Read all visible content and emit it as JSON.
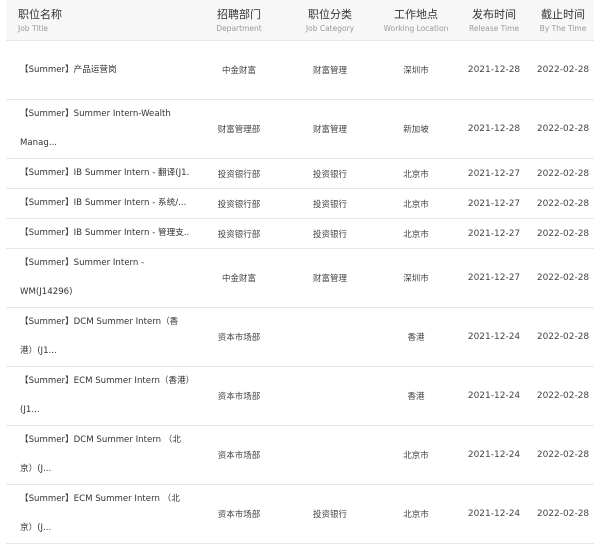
{
  "header": {
    "title": {
      "zh": "职位名称",
      "en": "Job Title"
    },
    "department": {
      "zh": "招聘部门",
      "en": "Department"
    },
    "category": {
      "zh": "职位分类",
      "en": "Job Category"
    },
    "location": {
      "zh": "工作地点",
      "en": "Working Location"
    },
    "release": {
      "zh": "发布时间",
      "en": "Release Time"
    },
    "deadline": {
      "zh": "截止时间",
      "en": "By The Time"
    }
  },
  "rows": [
    {
      "title": "【Summer】产品运营岗",
      "department": "中金财富",
      "category": "财富管理",
      "location": "深圳市",
      "release": "2021-12-28",
      "deadline": "2022-02-28"
    },
    {
      "title": "【Summer】Summer Intern-Wealth Manag...",
      "department": "财富管理部",
      "category": "财富管理",
      "location": "新加坡",
      "release": "2021-12-28",
      "deadline": "2022-02-28"
    },
    {
      "title": "【Summer】IB Summer Intern - 翻译(J1...",
      "department": "投资银行部",
      "category": "投资银行",
      "location": "北京市",
      "release": "2021-12-27",
      "deadline": "2022-02-28"
    },
    {
      "title": "【Summer】IB Summer Intern - 系统/...",
      "department": "投资银行部",
      "category": "投资银行",
      "location": "北京市",
      "release": "2021-12-27",
      "deadline": "2022-02-28"
    },
    {
      "title": "【Summer】IB Summer Intern - 管理支...",
      "department": "投资银行部",
      "category": "投资银行",
      "location": "北京市",
      "release": "2021-12-27",
      "deadline": "2022-02-28"
    },
    {
      "title": "【Summer】Summer Intern - WM(J14296)",
      "department": "中金财富",
      "category": "财富管理",
      "location": "深圳市",
      "release": "2021-12-27",
      "deadline": "2022-02-28"
    },
    {
      "title": "【Summer】DCM Summer Intern（香港）(J1...",
      "department": "资本市场部",
      "category": "",
      "location": "香港",
      "release": "2021-12-24",
      "deadline": "2022-02-28"
    },
    {
      "title": "【Summer】ECM Summer Intern（香港）(J1...",
      "department": "资本市场部",
      "category": "",
      "location": "香港",
      "release": "2021-12-24",
      "deadline": "2022-02-28"
    },
    {
      "title": "【Summer】DCM Summer Intern （北京）(J...",
      "department": "资本市场部",
      "category": "",
      "location": "北京市",
      "release": "2021-12-24",
      "deadline": "2022-02-28"
    },
    {
      "title": "【Summer】ECM Summer Intern （北京）(J...",
      "department": "资本市场部",
      "category": "投资银行",
      "location": "北京市",
      "release": "2021-12-24",
      "deadline": "2022-02-28"
    }
  ]
}
